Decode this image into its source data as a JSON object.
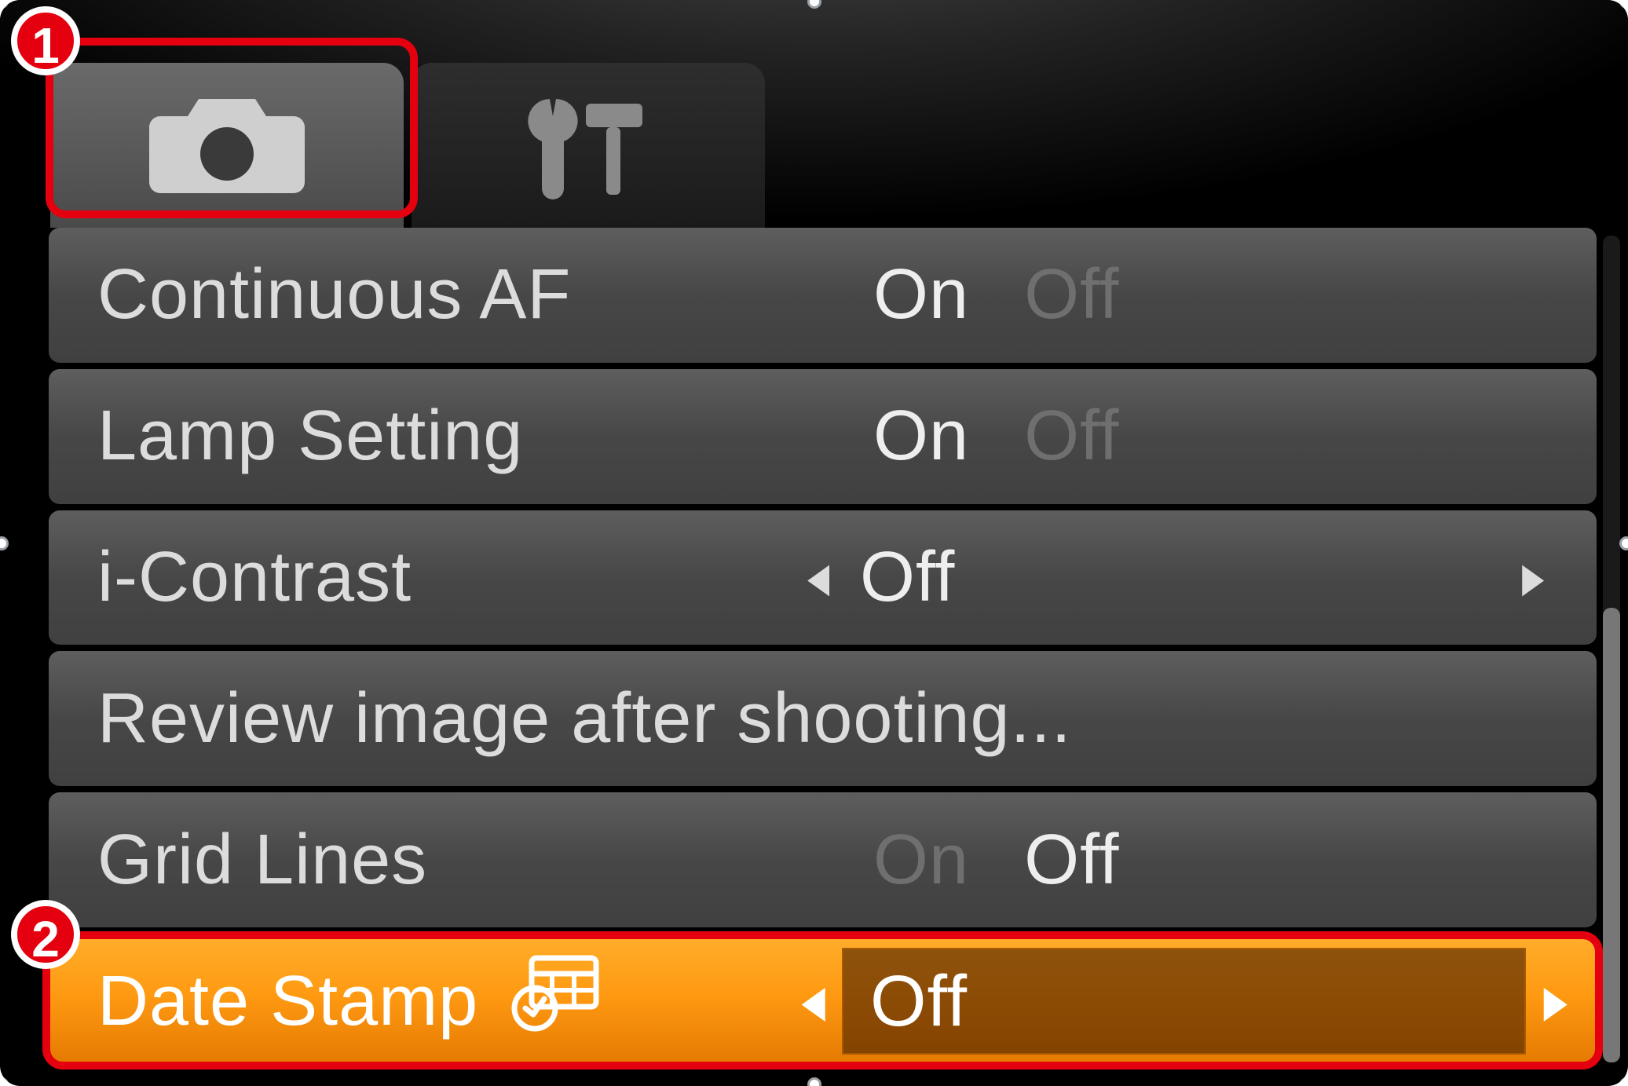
{
  "callouts": {
    "one": "1",
    "two": "2"
  },
  "tabs": {
    "shooting_icon": "camera-icon",
    "setup_icon": "tools-icon"
  },
  "menu": {
    "rows": [
      {
        "label": "Continuous AF",
        "on": "On",
        "off": "Off",
        "active": "on"
      },
      {
        "label": "Lamp Setting",
        "on": "On",
        "off": "Off",
        "active": "on"
      },
      {
        "label": "i-Contrast",
        "value": "Off"
      },
      {
        "label": "Review image after shooting..."
      },
      {
        "label": "Grid Lines",
        "on": "On",
        "off": "Off",
        "active": "off"
      },
      {
        "label": "Date Stamp",
        "value": "Off",
        "selected": true
      }
    ]
  }
}
